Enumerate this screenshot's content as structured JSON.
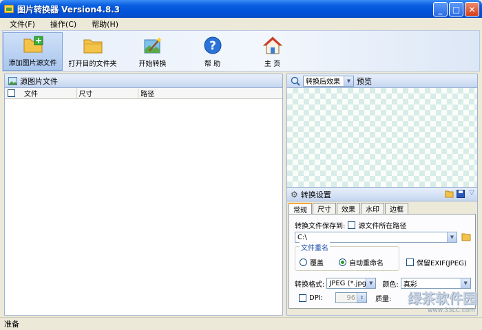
{
  "window": {
    "title": "图片转换器 Version4.8.3"
  },
  "window_buttons": {
    "minimize": "_",
    "maximize": "□",
    "close": "✕"
  },
  "menu": [
    "文件(F)",
    "操作(C)",
    "帮助(H)"
  ],
  "toolbar": {
    "add_source": "添加图片源文件",
    "open_folder": "打开目的文件夹",
    "start": "开始转换",
    "help": "帮 助",
    "home": "主 页"
  },
  "source_panel": {
    "title": "源图片文件",
    "columns": [
      "文件",
      "尺寸",
      "路径"
    ]
  },
  "preview_panel": {
    "mode_selected": "转换后效果",
    "label": "预览"
  },
  "settings_panel": {
    "title": "转换设置",
    "tabs": [
      "常规",
      "尺寸",
      "效果",
      "水印",
      "边框"
    ],
    "save_to_label": "转换文件保存到:",
    "source_path_label": "源文件所在路径",
    "save_path_value": "C:\\",
    "rename_group": "文件重名",
    "overwrite": "覆盖",
    "auto_rename": "自动重命名",
    "keep_exif": "保留EXIF(JPEG)",
    "format_label": "转换格式:",
    "format_value": "JPEG (*.jpg",
    "color_label": "颜色:",
    "color_value": "真彩",
    "dpi_label": "DPI:",
    "dpi_value": "96",
    "quality_label": "质量:"
  },
  "status": {
    "text": "准备"
  },
  "watermark": {
    "text": "绿茶软件园",
    "url": "www.33LC.com"
  }
}
